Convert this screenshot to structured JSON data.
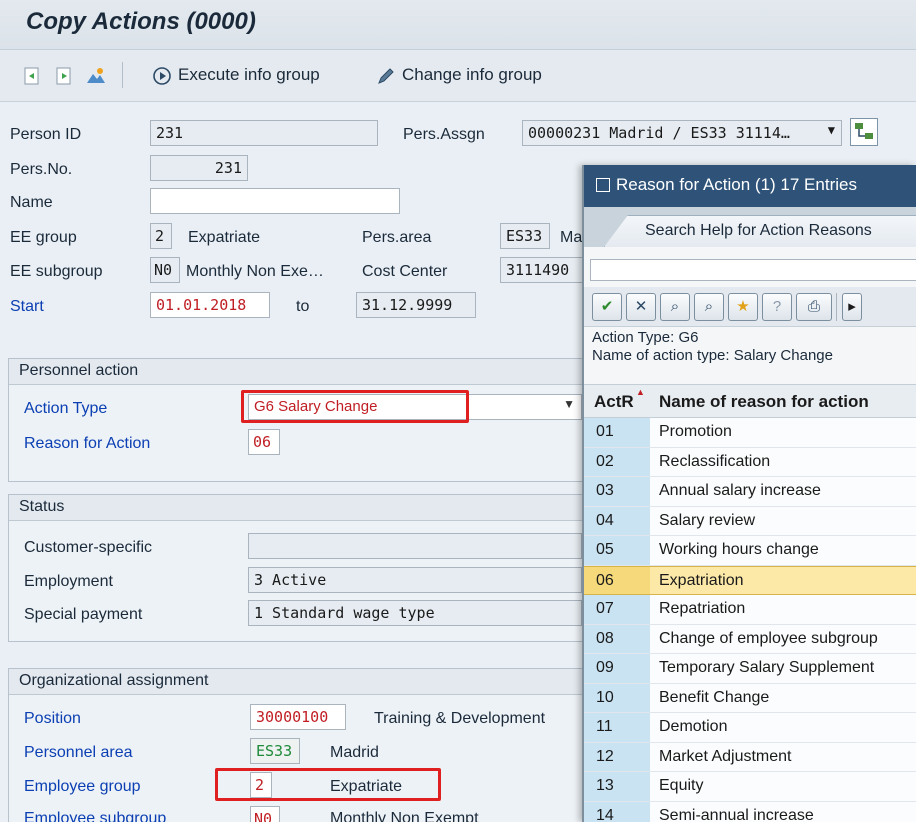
{
  "window": {
    "title": "Copy Actions (0000)"
  },
  "toolbar": {
    "buttons": [
      {
        "icon": "previous-record-icon"
      },
      {
        "icon": "next-record-icon"
      },
      {
        "icon": "overview-icon"
      }
    ],
    "execute_label": "Execute info group",
    "change_label": "Change info group"
  },
  "header": {
    "person_id_label": "Person ID",
    "person_id_value": "231",
    "pers_assgn_label": "Pers.Assgn",
    "pers_assgn_value": "00000231 Madrid / ES33 31114…",
    "pers_no_label": "Pers.No.",
    "pers_no_value": "231",
    "name_label": "Name",
    "name_value": "",
    "ee_group_label": "EE group",
    "ee_group_code": "2",
    "ee_group_text": "Expatriate",
    "pers_area_label": "Pers.area",
    "pers_area_code": "ES33",
    "pers_area_text": "Ma",
    "ee_subgroup_label": "EE subgroup",
    "ee_subgroup_code": "N0",
    "ee_subgroup_text": "Monthly Non Exe…",
    "cost_center_label": "Cost Center",
    "cost_center_value": "3111490",
    "start_label": "Start",
    "start_value": "01.01.2018",
    "to_label": "to",
    "end_value": "31.12.9999"
  },
  "personnel_action": {
    "title": "Personnel action",
    "action_type_label": "Action Type",
    "action_type_value": "G6 Salary Change",
    "reason_label": "Reason for Action",
    "reason_value": "06"
  },
  "status": {
    "title": "Status",
    "customer_label": "Customer-specific",
    "customer_value": "",
    "employment_label": "Employment",
    "employment_value": "3 Active",
    "special_label": "Special payment",
    "special_value": "1 Standard wage type"
  },
  "org": {
    "title": "Organizational assignment",
    "position_label": "Position",
    "position_code": "30000100",
    "position_text": "Training & Development",
    "pers_area_label": "Personnel area",
    "pers_area_code": "ES33",
    "pers_area_text": "Madrid",
    "ee_group_label": "Employee group",
    "ee_group_code": "2",
    "ee_group_text": "Expatriate",
    "ee_subgroup_label": "Employee subgroup",
    "ee_subgroup_code": "N0",
    "ee_subgroup_text": "Monthly Non Exempt"
  },
  "popup": {
    "title": "Reason for Action (1)   17 Entries",
    "tab_label": "Search Help for Action Reasons",
    "info_line1": "Action Type: G6",
    "info_line2": "Name of action type: Salary Change",
    "col_code": "ActR",
    "col_name": "Name of reason for action",
    "selected_code": "06",
    "rows": [
      {
        "code": "01",
        "name": "Promotion"
      },
      {
        "code": "02",
        "name": "Reclassification"
      },
      {
        "code": "03",
        "name": "Annual salary increase"
      },
      {
        "code": "04",
        "name": "Salary review"
      },
      {
        "code": "05",
        "name": "Working hours change"
      },
      {
        "code": "06",
        "name": "Expatriation"
      },
      {
        "code": "07",
        "name": "Repatriation"
      },
      {
        "code": "08",
        "name": "Change of employee subgroup"
      },
      {
        "code": "09",
        "name": "Temporary Salary Supplement"
      },
      {
        "code": "10",
        "name": "Benefit Change"
      },
      {
        "code": "11",
        "name": "Demotion"
      },
      {
        "code": "12",
        "name": "Market Adjustment"
      },
      {
        "code": "13",
        "name": "Equity"
      },
      {
        "code": "14",
        "name": "Semi-annual increase"
      }
    ]
  },
  "colors": {
    "accent": "#0b3fb3",
    "highlight_border": "#e02020",
    "selection": "#fce9a8",
    "popup_title_bg": "#2f5378"
  }
}
